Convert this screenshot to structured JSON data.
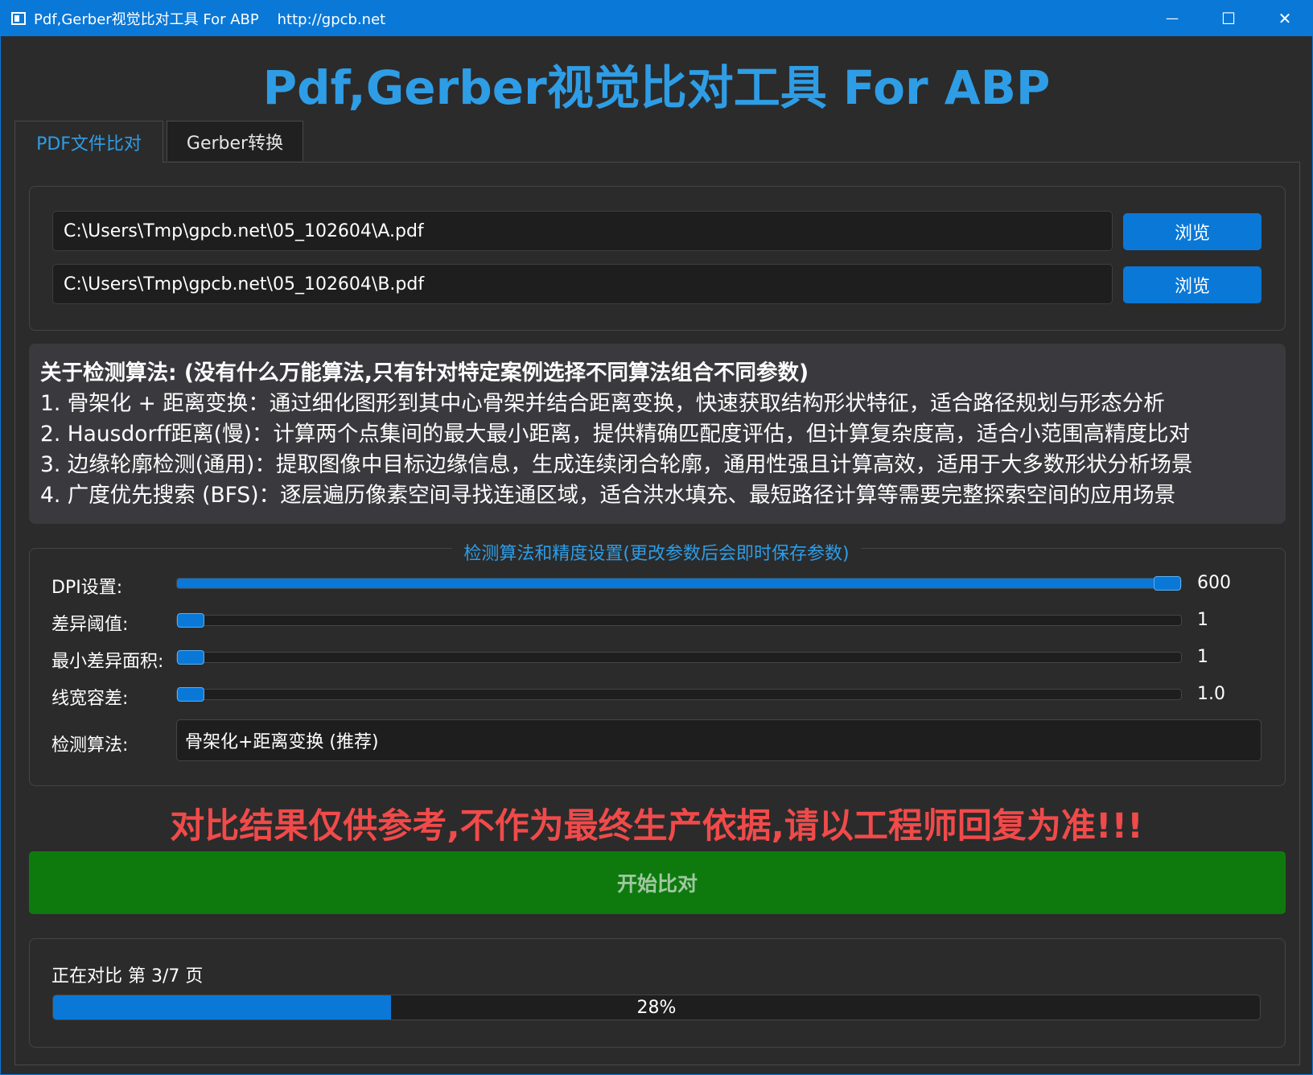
{
  "window": {
    "title": "Pdf,Gerber视觉比对工具 For ABP    http://gpcb.net",
    "controls": {
      "minimize": "—",
      "maximize": "☐",
      "close": "✕"
    }
  },
  "app_title": "Pdf,Gerber视觉比对工具 For ABP",
  "tabs": [
    {
      "label": "PDF文件比对",
      "active": true
    },
    {
      "label": "Gerber转换",
      "active": false
    }
  ],
  "files": {
    "file_a": "C:\\Users\\Tmp\\gpcb.net\\05_102604\\A.pdf",
    "file_b": "C:\\Users\\Tmp\\gpcb.net\\05_102604\\B.pdf",
    "browse_label": "浏览"
  },
  "algorithm_info": {
    "heading": "关于检测算法: (没有什么万能算法,只有针对特定案例选择不同算法组合不同参数)",
    "lines": [
      "1. 骨架化 + 距离变换：通过细化图形到其中心骨架并结合距离变换，快速获取结构形状特征，适合路径规划与形态分析",
      "2. Hausdorff距离(慢)：计算两个点集间的最大最小距离，提供精确匹配度评估，但计算复杂度高，适合小范围高精度比对",
      "3. 边缘轮廓检测(通用)：提取图像中目标边缘信息，生成连续闭合轮廓，通用性强且计算高效，适用于大多数形状分析场景",
      "4. 广度优先搜索 (BFS)：逐层遍历像素空间寻找连通区域，适合洪水填充、最短路径计算等需要完整探索空间的应用场景"
    ]
  },
  "settings": {
    "group_title": "检测算法和精度设置(更改参数后会即时保存参数)",
    "sliders": [
      {
        "label": "DPI设置:",
        "value": "600",
        "fraction": 1.0
      },
      {
        "label": "差异阈值:",
        "value": "1",
        "fraction": 0.0
      },
      {
        "label": "最小差异面积:",
        "value": "1",
        "fraction": 0.0
      },
      {
        "label": "线宽容差:",
        "value": "1.0",
        "fraction": 0.0
      }
    ],
    "algorithm_label": "检测算法:",
    "algorithm_value": "骨架化+距离变换 (推荐)"
  },
  "warning": "对比结果仅供参考,不作为最终生产依据,请以工程师回复为准!!!",
  "start_button": "开始比对",
  "status": {
    "text": "正在对比 第 3/7 页",
    "progress_percent": 28,
    "progress_label": "28%"
  },
  "colors": {
    "accent_blue": "#0a78d7",
    "title_blue": "#2e9de6",
    "warning_red": "#f04a4a",
    "start_green": "#0e7a0e",
    "background": "#2b2b2b"
  }
}
